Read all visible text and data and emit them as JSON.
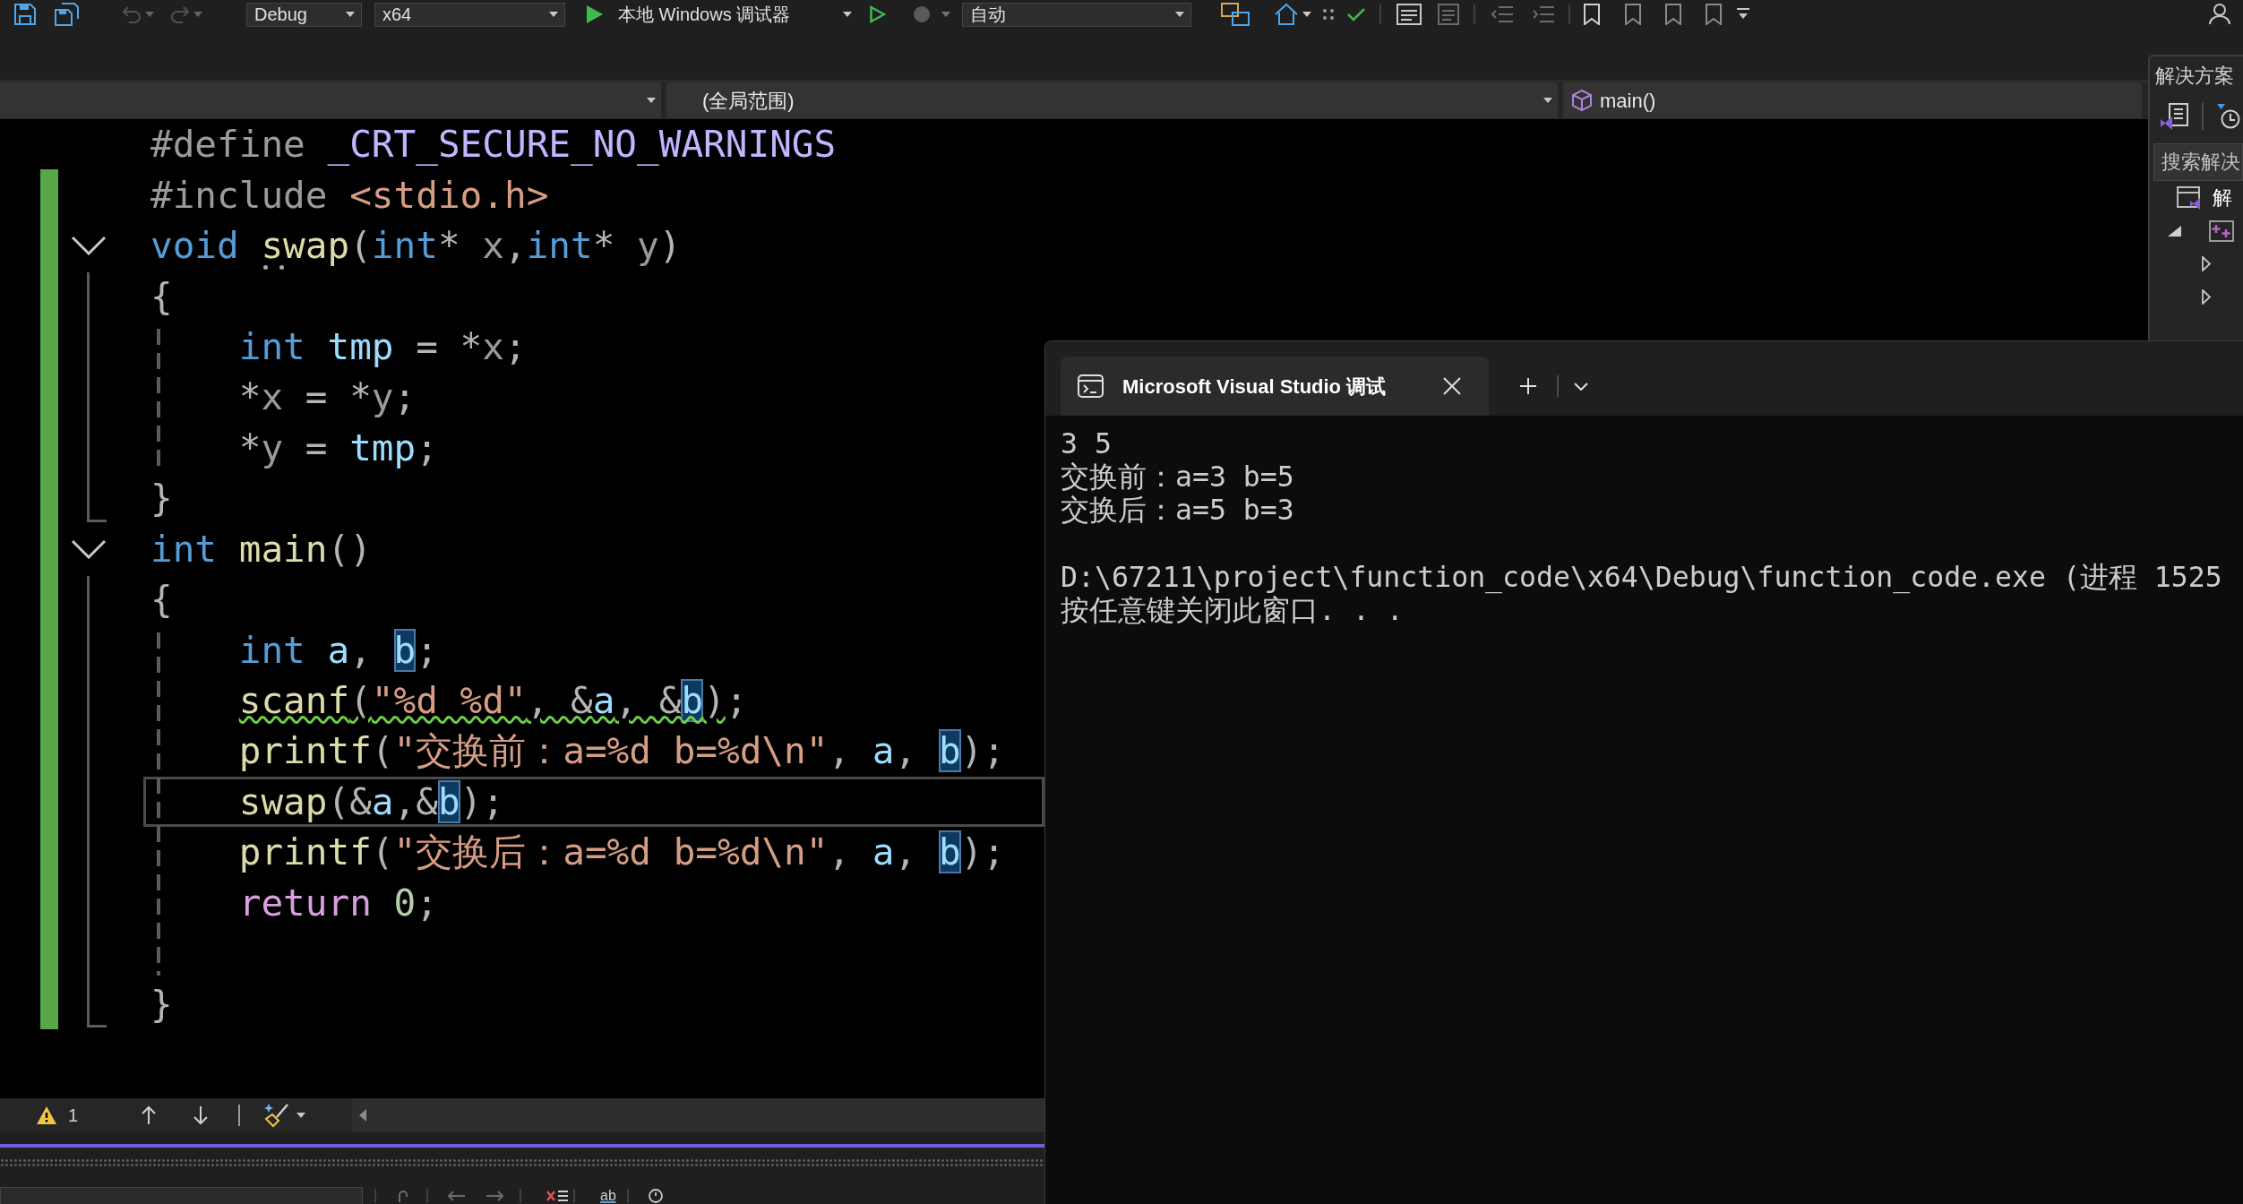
{
  "toolbar": {
    "undo": {
      "disabled": true
    },
    "redo": {
      "disabled": true
    },
    "configuration": "Debug",
    "platform": "x64",
    "debugger": "本地 Windows 调试器",
    "mode": "自动"
  },
  "nav_bar": {
    "scope": "(全局范围)",
    "member": "main()"
  },
  "editor": {
    "lines": [
      {
        "changed": false,
        "current": false,
        "tokens": [
          {
            "kind": "preproc",
            "text": "#define"
          },
          {
            "kind": "macro",
            "text": " _CRT_SECURE_NO_WARNINGS"
          }
        ]
      },
      {
        "changed": true,
        "current": false,
        "tokens": [
          {
            "kind": "preproc",
            "text": "#include "
          },
          {
            "kind": "string",
            "text": "<stdio.h>"
          }
        ]
      },
      {
        "changed": true,
        "current": false,
        "expanded": true,
        "tokens": [
          {
            "kind": "keyword",
            "text": "void "
          },
          {
            "kind": "suggestion",
            "tokens": [
              {
                "kind": "function",
                "text": "swap"
              }
            ]
          },
          {
            "kind": "punct",
            "text": "("
          },
          {
            "kind": "keyword",
            "text": "int"
          },
          {
            "kind": "punct",
            "text": "* "
          },
          {
            "kind": "param",
            "text": "x"
          },
          {
            "kind": "punct",
            "text": ","
          },
          {
            "kind": "keyword",
            "text": "int"
          },
          {
            "kind": "punct",
            "text": "* "
          },
          {
            "kind": "param",
            "text": "y"
          },
          {
            "kind": "punct",
            "text": ")"
          }
        ],
        "children": [
          {
            "changed": true,
            "current": false,
            "tokens": [
              {
                "kind": "punct",
                "text": "{"
              }
            ],
            "children": [
              {
                "changed": true,
                "current": false,
                "tokens": [
                  {
                    "kind": "keyword",
                    "text": "int "
                  },
                  {
                    "kind": "local",
                    "text": "tmp"
                  },
                  {
                    "kind": "punct",
                    "text": " = *"
                  },
                  {
                    "kind": "param",
                    "text": "x"
                  },
                  {
                    "kind": "punct",
                    "text": ";"
                  }
                ]
              },
              {
                "changed": true,
                "current": false,
                "tokens": [
                  {
                    "kind": "punct",
                    "text": "*"
                  },
                  {
                    "kind": "param",
                    "text": "x"
                  },
                  {
                    "kind": "punct",
                    "text": " = *"
                  },
                  {
                    "kind": "param",
                    "text": "y"
                  },
                  {
                    "kind": "punct",
                    "text": ";"
                  }
                ]
              },
              {
                "changed": true,
                "current": false,
                "tokens": [
                  {
                    "kind": "punct",
                    "text": "*"
                  },
                  {
                    "kind": "param",
                    "text": "y"
                  },
                  {
                    "kind": "punct",
                    "text": " = "
                  },
                  {
                    "kind": "local",
                    "text": "tmp"
                  },
                  {
                    "kind": "punct",
                    "text": ";"
                  }
                ]
              }
            ]
          },
          {
            "changed": true,
            "current": false,
            "tokens": [
              {
                "kind": "punct",
                "text": "}"
              }
            ]
          }
        ]
      },
      {
        "changed": true,
        "current": false,
        "expanded": true,
        "tokens": [
          {
            "kind": "keyword",
            "text": "int "
          },
          {
            "kind": "function",
            "text": "main"
          },
          {
            "kind": "punct",
            "text": "()"
          }
        ],
        "children": [
          {
            "changed": true,
            "current": false,
            "tokens": [
              {
                "kind": "punct",
                "text": "{"
              }
            ],
            "children": [
              {
                "changed": true,
                "current": false,
                "tokens": [
                  {
                    "kind": "keyword",
                    "text": "int "
                  },
                  {
                    "kind": "local",
                    "text": "a"
                  },
                  {
                    "kind": "punct",
                    "text": ", "
                  },
                  {
                    "kind": "ref",
                    "text": "b"
                  },
                  {
                    "kind": "punct",
                    "text": ";"
                  }
                ]
              },
              {
                "changed": true,
                "current": false,
                "tokens": [
                  {
                    "kind": "warning",
                    "tokens": [
                      {
                        "kind": "function",
                        "text": "scanf"
                      },
                      {
                        "kind": "punct",
                        "text": "("
                      },
                      {
                        "kind": "string",
                        "text": "\"%d %d\""
                      },
                      {
                        "kind": "punct",
                        "text": ", &"
                      },
                      {
                        "kind": "local",
                        "text": "a"
                      },
                      {
                        "kind": "punct",
                        "text": ", &"
                      },
                      {
                        "kind": "ref",
                        "text": "b"
                      },
                      {
                        "kind": "punct",
                        "text": ")"
                      }
                    ]
                  },
                  {
                    "kind": "punct",
                    "text": ";"
                  }
                ]
              },
              {
                "changed": true,
                "current": false,
                "tokens": [
                  {
                    "kind": "function",
                    "text": "printf"
                  },
                  {
                    "kind": "punct",
                    "text": "("
                  },
                  {
                    "kind": "string",
                    "text": "\"交换前：a=%d b=%d\\n\""
                  },
                  {
                    "kind": "punct",
                    "text": ", "
                  },
                  {
                    "kind": "local",
                    "text": "a"
                  },
                  {
                    "kind": "punct",
                    "text": ", "
                  },
                  {
                    "kind": "ref",
                    "text": "b"
                  },
                  {
                    "kind": "punct",
                    "text": ");"
                  }
                ]
              },
              {
                "changed": true,
                "current": true,
                "tokens": [
                  {
                    "kind": "function",
                    "text": "swap"
                  },
                  {
                    "kind": "punct",
                    "text": "(&"
                  },
                  {
                    "kind": "local",
                    "text": "a"
                  },
                  {
                    "kind": "punct",
                    "text": ",&"
                  },
                  {
                    "kind": "ref",
                    "text": "b"
                  },
                  {
                    "kind": "punct",
                    "text": ");"
                  }
                ]
              },
              {
                "changed": true,
                "current": false,
                "tokens": [
                  {
                    "kind": "function",
                    "text": "printf"
                  },
                  {
                    "kind": "punct",
                    "text": "("
                  },
                  {
                    "kind": "string",
                    "text": "\"交换后：a=%d b=%d\\n\""
                  },
                  {
                    "kind": "punct",
                    "text": ", "
                  },
                  {
                    "kind": "local",
                    "text": "a"
                  },
                  {
                    "kind": "punct",
                    "text": ", "
                  },
                  {
                    "kind": "ref",
                    "text": "b"
                  },
                  {
                    "kind": "punct",
                    "text": ");"
                  }
                ]
              },
              {
                "changed": true,
                "current": false,
                "tokens": [
                  {
                    "kind": "control",
                    "text": "return "
                  },
                  {
                    "kind": "number",
                    "text": "0"
                  },
                  {
                    "kind": "punct",
                    "text": ";"
                  }
                ]
              },
              {
                "changed": true,
                "current": false
              }
            ]
          },
          {
            "changed": true,
            "current": false,
            "tokens": [
              {
                "kind": "punct",
                "text": "}"
              }
            ]
          }
        ]
      }
    ]
  },
  "status_bar": {
    "warnings": "1"
  },
  "bottom_toolbar": {
    "toggle_label": "ab"
  },
  "solution_explorer": {
    "title": "解决方案",
    "search": {
      "placeholder": "搜索解决"
    },
    "tree": [
      {
        "label": "解",
        "kind": "solution",
        "children": [
          {
            "kind": "project",
            "expanded": true,
            "children": [
              {
                "expanded": false
              },
              {
                "expanded": false
              }
            ]
          }
        ]
      }
    ]
  },
  "terminal": {
    "tab": {
      "title": "Microsoft Visual Studio 调试"
    },
    "blocks": [
      {
        "lines": [
          "3 5",
          "交换前：a=3 b=5",
          "交换后：a=5 b=3"
        ]
      },
      {
        "lines": [
          "D:\\67211\\project\\function_code\\x64\\Debug\\function_code.exe (进程 1525",
          "按任意键关闭此窗口. . ."
        ]
      }
    ]
  }
}
